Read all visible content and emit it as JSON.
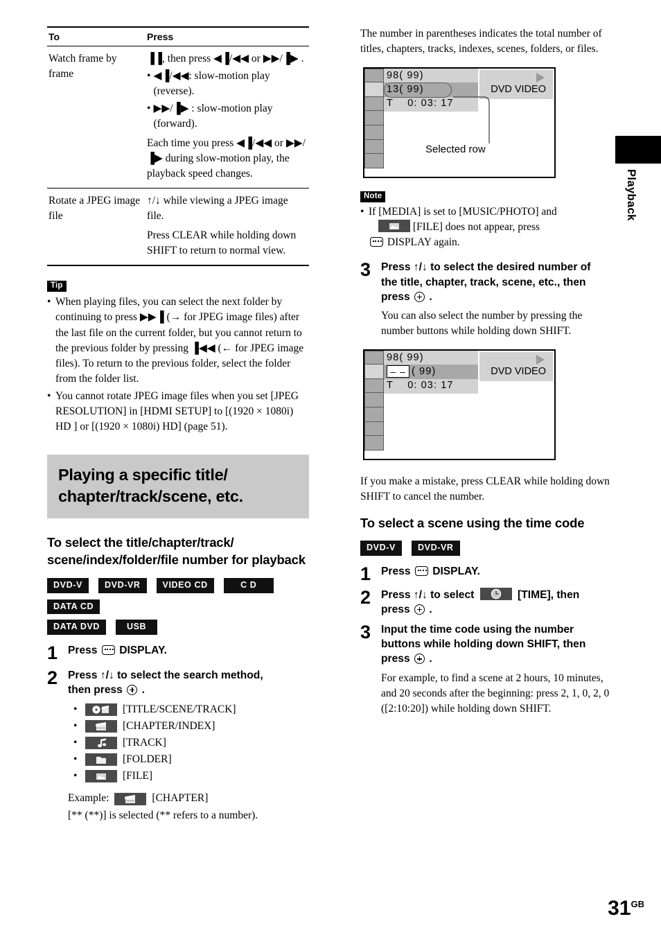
{
  "table": {
    "headers": [
      "To",
      "Press"
    ],
    "rows": [
      {
        "to": "Watch frame by frame",
        "press_main": "▐▐, then press ◀▐/◀◀ or ▶▶/▐▶ .",
        "bullets": [
          "◀▐/◀◀: slow-motion play (reverse).",
          "▶▶/▐▶ : slow-motion play (forward)."
        ],
        "press_tail": "Each time you press ◀▐/◀◀ or ▶▶/▐▶ during slow-motion play, the playback speed changes."
      },
      {
        "to": "Rotate a JPEG image file",
        "press_main": "↑/↓ while viewing a JPEG image file.",
        "press_tail": "Press CLEAR while holding down SHIFT to return to normal view."
      }
    ]
  },
  "tip": {
    "badge": "Tip",
    "items": [
      "When playing files, you can select the next folder by continuing to press ▶▶▐ (→ for JPEG image files) after the last file on the current folder, but you cannot return to the previous folder by pressing ▐◀◀ (← for JPEG image files). To return to the previous folder, select the folder from the folder list.",
      "You cannot rotate JPEG image files when you set [JPEG RESOLUTION] in [HDMI SETUP] to [(1920 × 1080i) HD ] or [(1920 × 1080i) HD] (page 51)."
    ]
  },
  "section": {
    "heading": "Playing a specific title/ chapter/track/scene, etc.",
    "subheading": "To select the title/chapter/track/ scene/index/folder/file number for playback",
    "disc_badges": [
      "DVD-V",
      "DVD-VR",
      "VIDEO CD",
      "C D",
      "DATA CD",
      "DATA DVD",
      "USB"
    ]
  },
  "steps_left": [
    {
      "num": "1",
      "title_pre": "Press",
      "title_post": "DISPLAY."
    },
    {
      "num": "2",
      "title_pre": "Press ↑/↓ to select the search method,",
      "title_mid": "then press",
      "title_post": ".",
      "options": [
        {
          "icon": "title-scene-track-icon",
          "label": "[TITLE/SCENE/TRACK]"
        },
        {
          "icon": "chapter-index-icon",
          "label": "[CHAPTER/INDEX]"
        },
        {
          "icon": "track-icon",
          "label": "[TRACK]"
        },
        {
          "icon": "folder-icon",
          "label": "[FOLDER]"
        },
        {
          "icon": "file-icon",
          "label": "[FILE]"
        }
      ],
      "example_label": "Example:",
      "example_value": "[CHAPTER]",
      "example_note": "[** (**)] is selected (** refers to a number)."
    }
  ],
  "right": {
    "intro": "The number in parentheses indicates the total number of titles, chapters, tracks, indexes, scenes, folders, or files.",
    "osd1": {
      "row1": "98( 99)",
      "row2": "13( 99)",
      "row3": "T    0: 03: 17",
      "label": "DVD VIDEO",
      "callout": "Selected row"
    },
    "note": {
      "badge": "Note",
      "text_pre": "If [MEDIA] is set to [MUSIC/PHOTO] and",
      "text_mid": "[FILE] does not appear, press",
      "text_post": "DISPLAY again."
    },
    "step3": {
      "num": "3",
      "title_pre": "Press ↑/↓ to select the desired number of the title, chapter, track, scene, etc., then press",
      "title_post": ".",
      "expl": "You can also select the number by pressing the number buttons while holding down SHIFT."
    },
    "osd2": {
      "row1": "98( 99)",
      "row2_dashes": "– –",
      "row2_rest": "( 99)",
      "row3": "T    0: 03: 17",
      "label": "DVD VIDEO"
    },
    "mistake": "If you make a mistake, press CLEAR while holding down SHIFT to cancel the number.",
    "timecode_heading": "To select a scene using the time code",
    "timecode_badges": [
      "DVD-V",
      "DVD-VR"
    ],
    "timecode_steps": [
      {
        "num": "1",
        "title_pre": "Press",
        "title_post": "DISPLAY."
      },
      {
        "num": "2",
        "title_pre": "Press ↑/↓ to select",
        "title_mid": "[TIME], then press",
        "title_post": "."
      },
      {
        "num": "3",
        "title_pre": "Input the time code using the number buttons while holding down SHIFT, then press",
        "title_post": ".",
        "expl": "For example, to find a scene at 2 hours, 10 minutes, and 20 seconds after the beginning: press 2, 1, 0, 2, 0 ([2:10:20]) while holding down SHIFT."
      }
    ]
  },
  "sidetab": {
    "label": "Playback"
  },
  "page": {
    "number": "31",
    "suffix": "GB"
  }
}
